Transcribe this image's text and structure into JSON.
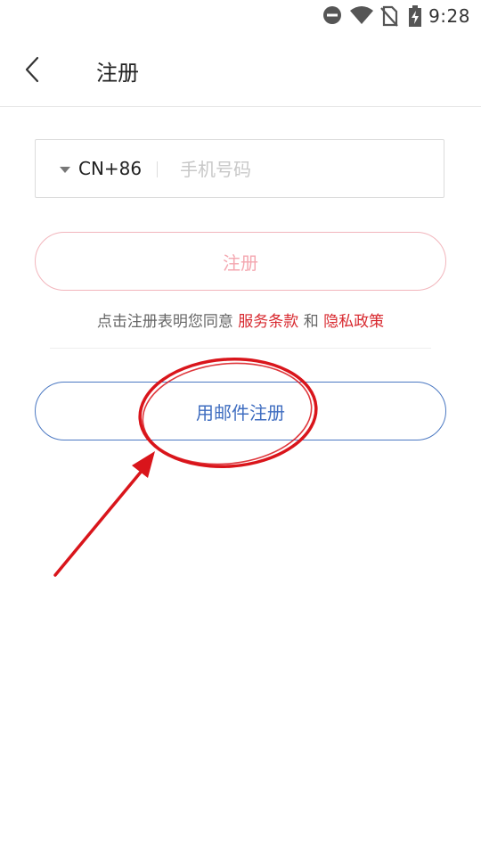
{
  "status_bar": {
    "time": "9:28",
    "icons": [
      "do-not-disturb-icon",
      "wifi-icon",
      "no-sim-icon",
      "battery-charging-icon"
    ]
  },
  "app_bar": {
    "back_icon": "chevron-left-icon",
    "title": "注册"
  },
  "form": {
    "country_code": "CN+86",
    "phone_placeholder": "手机号码",
    "phone_value": "",
    "register_label": "注册"
  },
  "agreement": {
    "prefix": "点击注册表明您同意 ",
    "terms_link": "服务条款",
    "joiner": " 和 ",
    "privacy_link": "隐私政策"
  },
  "email_register_label": "用邮件注册",
  "colors": {
    "link_red": "#d8292f",
    "register_disabled_pink": "#f4a7b0",
    "email_button_blue": "#3f6dc0",
    "annotation_red": "#d9151b"
  }
}
